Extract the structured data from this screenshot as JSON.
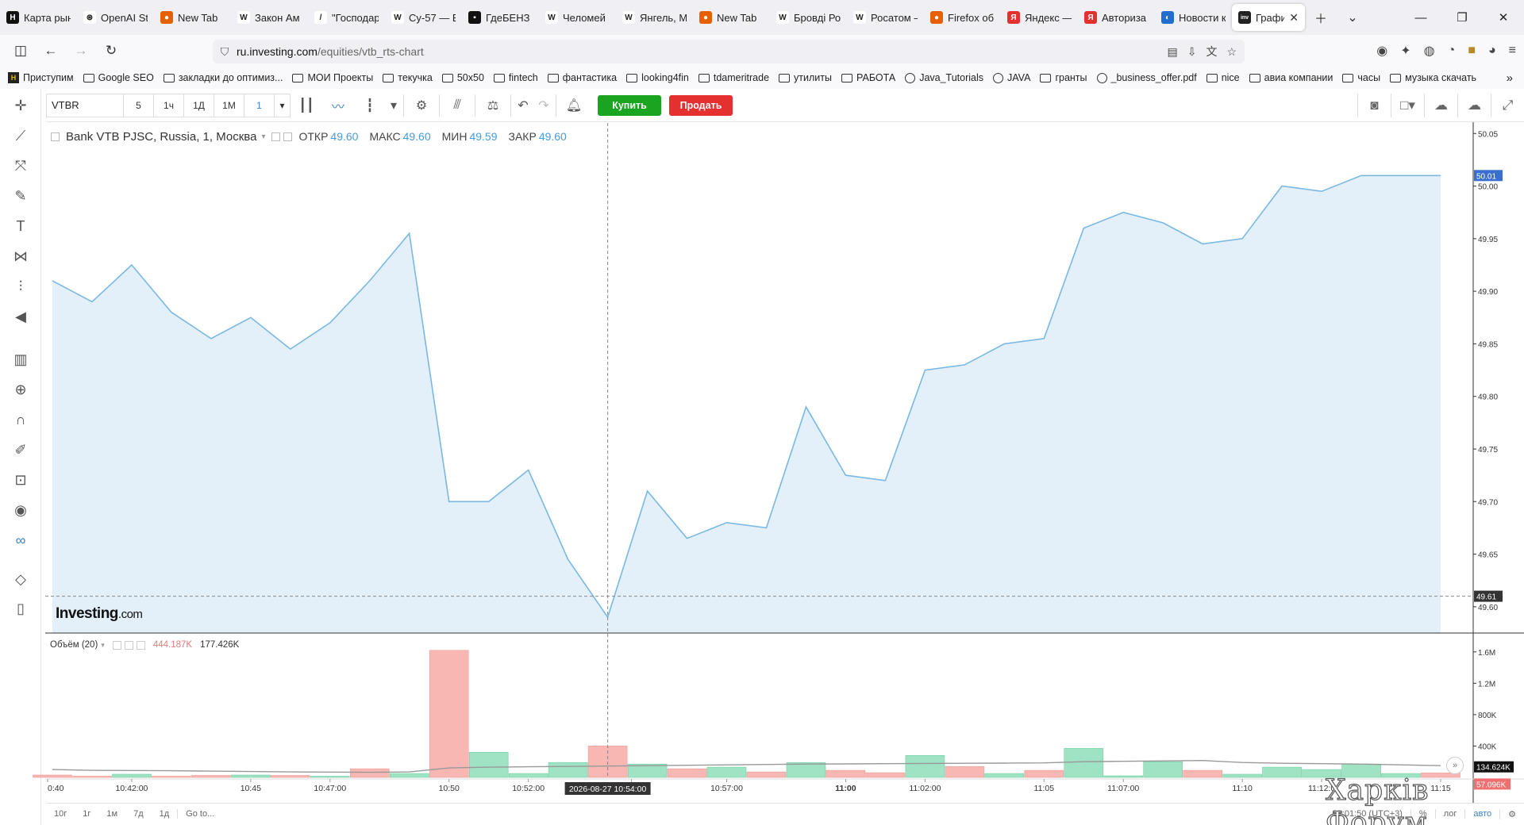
{
  "browser": {
    "tabs": [
      {
        "label": "Карта рын",
        "icon_color": "#111111",
        "icon_char": "H"
      },
      {
        "label": "OpenAI St",
        "icon_color": "#ffffff",
        "icon_char": "⊛"
      },
      {
        "label": "New Tab",
        "icon_color": "#e66000",
        "icon_char": "●"
      },
      {
        "label": "Закон Ам",
        "icon_color": "#ffffff",
        "icon_char": "W"
      },
      {
        "label": "\"Господар",
        "icon_color": "#ffffff",
        "icon_char": "/"
      },
      {
        "label": "Су-57 — В",
        "icon_color": "#ffffff",
        "icon_char": "W"
      },
      {
        "label": "ГдеБЕНЗ -",
        "icon_color": "#111111",
        "icon_char": "▪"
      },
      {
        "label": "Челомей",
        "icon_color": "#ffffff",
        "icon_char": "W"
      },
      {
        "label": "Янгель, М",
        "icon_color": "#ffffff",
        "icon_char": "W"
      },
      {
        "label": "New Tab",
        "icon_color": "#e66000",
        "icon_char": "●"
      },
      {
        "label": "Бровді Ро",
        "icon_color": "#ffffff",
        "icon_char": "W"
      },
      {
        "label": "Росатом –",
        "icon_color": "#ffffff",
        "icon_char": "W"
      },
      {
        "label": "Firefox об",
        "icon_color": "#e66000",
        "icon_char": "●"
      },
      {
        "label": "Яндекс —",
        "icon_color": "#e53030",
        "icon_char": "Я"
      },
      {
        "label": "Авториза",
        "icon_color": "#e53030",
        "icon_char": "Я"
      },
      {
        "label": "Новости к",
        "icon_color": "#1f6fd1",
        "icon_char": "◐"
      }
    ],
    "active_tab": {
      "label": "График",
      "icon_char": "inv",
      "icon_color": "#222222"
    },
    "url_host": "ru.investing.com",
    "url_path": "/equities/vtb_rts-chart",
    "bookmarks": [
      {
        "label": "Приступим",
        "kind": "app"
      },
      {
        "label": "Google SEO",
        "kind": "folder"
      },
      {
        "label": "закладки до оптимиз...",
        "kind": "folder"
      },
      {
        "label": "МОИ Проекты",
        "kind": "folder"
      },
      {
        "label": "текучка",
        "kind": "folder"
      },
      {
        "label": "50x50",
        "kind": "folder"
      },
      {
        "label": "fintech",
        "kind": "folder"
      },
      {
        "label": "фантастика",
        "kind": "folder"
      },
      {
        "label": "looking4fin",
        "kind": "folder"
      },
      {
        "label": "tdameritrade",
        "kind": "folder"
      },
      {
        "label": "утилиты",
        "kind": "folder"
      },
      {
        "label": "РАБОТА",
        "kind": "folder"
      },
      {
        "label": "Java_Tutorials",
        "kind": "globe"
      },
      {
        "label": "JAVA",
        "kind": "globe"
      },
      {
        "label": "гранты",
        "kind": "folder"
      },
      {
        "label": "_business_offer.pdf",
        "kind": "globe"
      },
      {
        "label": "nice",
        "kind": "folder"
      },
      {
        "label": "авиа компании",
        "kind": "folder"
      },
      {
        "label": "часы",
        "kind": "folder"
      },
      {
        "label": "музыка скачать",
        "kind": "folder"
      }
    ]
  },
  "toolbar": {
    "symbol": "VTBR",
    "timeframes": [
      "5",
      "1ч",
      "1Д",
      "1М",
      "1"
    ],
    "selected_timeframe": "1",
    "buy_label": "Купить",
    "sell_label": "Продать",
    "buy_color": "#1aa520",
    "sell_color": "#e53030"
  },
  "legend": {
    "title": "Bank VTB PJSC, Russia, 1, Москва",
    "open_label": "ОТКР",
    "open_value": "49.60",
    "high_label": "МАКС",
    "high_value": "49.60",
    "low_label": "МИН",
    "low_value": "49.59",
    "close_label": "ЗАКР",
    "close_value": "49.60"
  },
  "volume_legend": {
    "label": "Объём (20)",
    "value1": "444.187K",
    "value2": "177.426K"
  },
  "logo": {
    "brand": "Investing",
    "suffix": ".com"
  },
  "crosshair": {
    "time_label": "2026-08-27 10:54:00",
    "price_label": "49.61",
    "volume_label": "134.624K"
  },
  "last_price_label": "50.01",
  "last_volume_label": "57.096K",
  "bottom": {
    "ranges": [
      "10г",
      "1г",
      "1м",
      "7д",
      "1д"
    ],
    "goto": "Go to...",
    "clock": "08:01:50 (UTC+3)",
    "percent": "%",
    "log": "лог",
    "auto": "авто"
  },
  "watermark": "Харків Форум",
  "chart_data": [
    {
      "type": "area",
      "title": "Bank VTB PJSC, Russia, 1, Москва",
      "x": [
        "10:40",
        "10:41",
        "10:42",
        "10:43",
        "10:44",
        "10:45",
        "10:46",
        "10:47",
        "10:48",
        "10:49",
        "10:50",
        "10:51",
        "10:52",
        "10:53",
        "10:54",
        "10:55",
        "10:56",
        "10:57",
        "10:58",
        "10:59",
        "11:00",
        "11:01",
        "11:02",
        "11:03",
        "11:04",
        "11:05",
        "11:06",
        "11:07",
        "11:08",
        "11:09",
        "11:10",
        "11:11",
        "11:12",
        "11:13",
        "11:14",
        "11:15"
      ],
      "values": [
        49.91,
        49.89,
        49.925,
        49.88,
        49.855,
        49.875,
        49.845,
        49.87,
        49.91,
        49.955,
        49.7,
        49.7,
        49.73,
        49.645,
        49.59,
        49.71,
        49.665,
        49.68,
        49.675,
        49.79,
        49.725,
        49.72,
        49.825,
        49.83,
        49.85,
        49.855,
        49.96,
        49.975,
        49.965,
        49.945,
        49.95,
        50.0,
        49.995,
        50.01,
        50.01,
        50.01
      ],
      "ylim": [
        49.575,
        50.06
      ],
      "y_ticks": [
        "50.05",
        "50.00",
        "49.95",
        "49.90",
        "49.85",
        "49.80",
        "49.75",
        "49.70",
        "49.65",
        "49.60"
      ],
      "x_ticks": [
        "0:40",
        "10:42:00",
        "10:45",
        "10:47:00",
        "10:50",
        "10:52:00",
        "5",
        "10:57:00",
        "11:00",
        "11:02:00",
        "11:05",
        "11:07:00",
        "11:10",
        "11:12:0",
        "11:15"
      ],
      "line_color": "#7ab8e4",
      "fill_color": "#e3f0fa"
    },
    {
      "type": "bar",
      "title": "Объём (20)",
      "x": [
        "10:40",
        "10:41",
        "10:42",
        "10:43",
        "10:44",
        "10:45",
        "10:46",
        "10:47",
        "10:48",
        "10:49",
        "10:50",
        "10:51",
        "10:52",
        "10:53",
        "10:54",
        "10:55",
        "10:56",
        "10:57",
        "10:58",
        "10:59",
        "11:00",
        "11:01",
        "11:02",
        "11:03",
        "11:04",
        "11:05",
        "11:06",
        "11:07",
        "11:08",
        "11:09",
        "11:10",
        "11:11",
        "11:12",
        "11:13",
        "11:14",
        "11:15"
      ],
      "values": [
        30,
        15,
        40,
        15,
        25,
        30,
        25,
        15,
        110,
        50,
        1620,
        320,
        50,
        190,
        400,
        170,
        110,
        130,
        70,
        190,
        90,
        60,
        280,
        140,
        50,
        90,
        370,
        20,
        200,
        90,
        40,
        130,
        100,
        170,
        50,
        57
      ],
      "direction": [
        "down",
        "down",
        "up",
        "down",
        "down",
        "up",
        "down",
        "up",
        "down",
        "up",
        "down",
        "up",
        "up",
        "up",
        "down",
        "up",
        "down",
        "up",
        "down",
        "up",
        "down",
        "down",
        "up",
        "down",
        "up",
        "down",
        "up",
        "up",
        "up",
        "down",
        "up",
        "up",
        "up",
        "up",
        "up",
        "down"
      ],
      "ma_values": [
        100,
        90,
        88,
        85,
        80,
        75,
        70,
        68,
        65,
        70,
        120,
        130,
        135,
        140,
        145,
        150,
        155,
        160,
        165,
        170,
        172,
        175,
        178,
        180,
        182,
        185,
        200,
        205,
        210,
        215,
        190,
        180,
        175,
        170,
        160,
        150
      ],
      "y_ticks": [
        "1.6M",
        "1.2M",
        "800K",
        "400K"
      ],
      "ylim": [
        0,
        1800
      ],
      "up_color": "#9fe3c4",
      "down_color": "#f8b7b3"
    }
  ]
}
